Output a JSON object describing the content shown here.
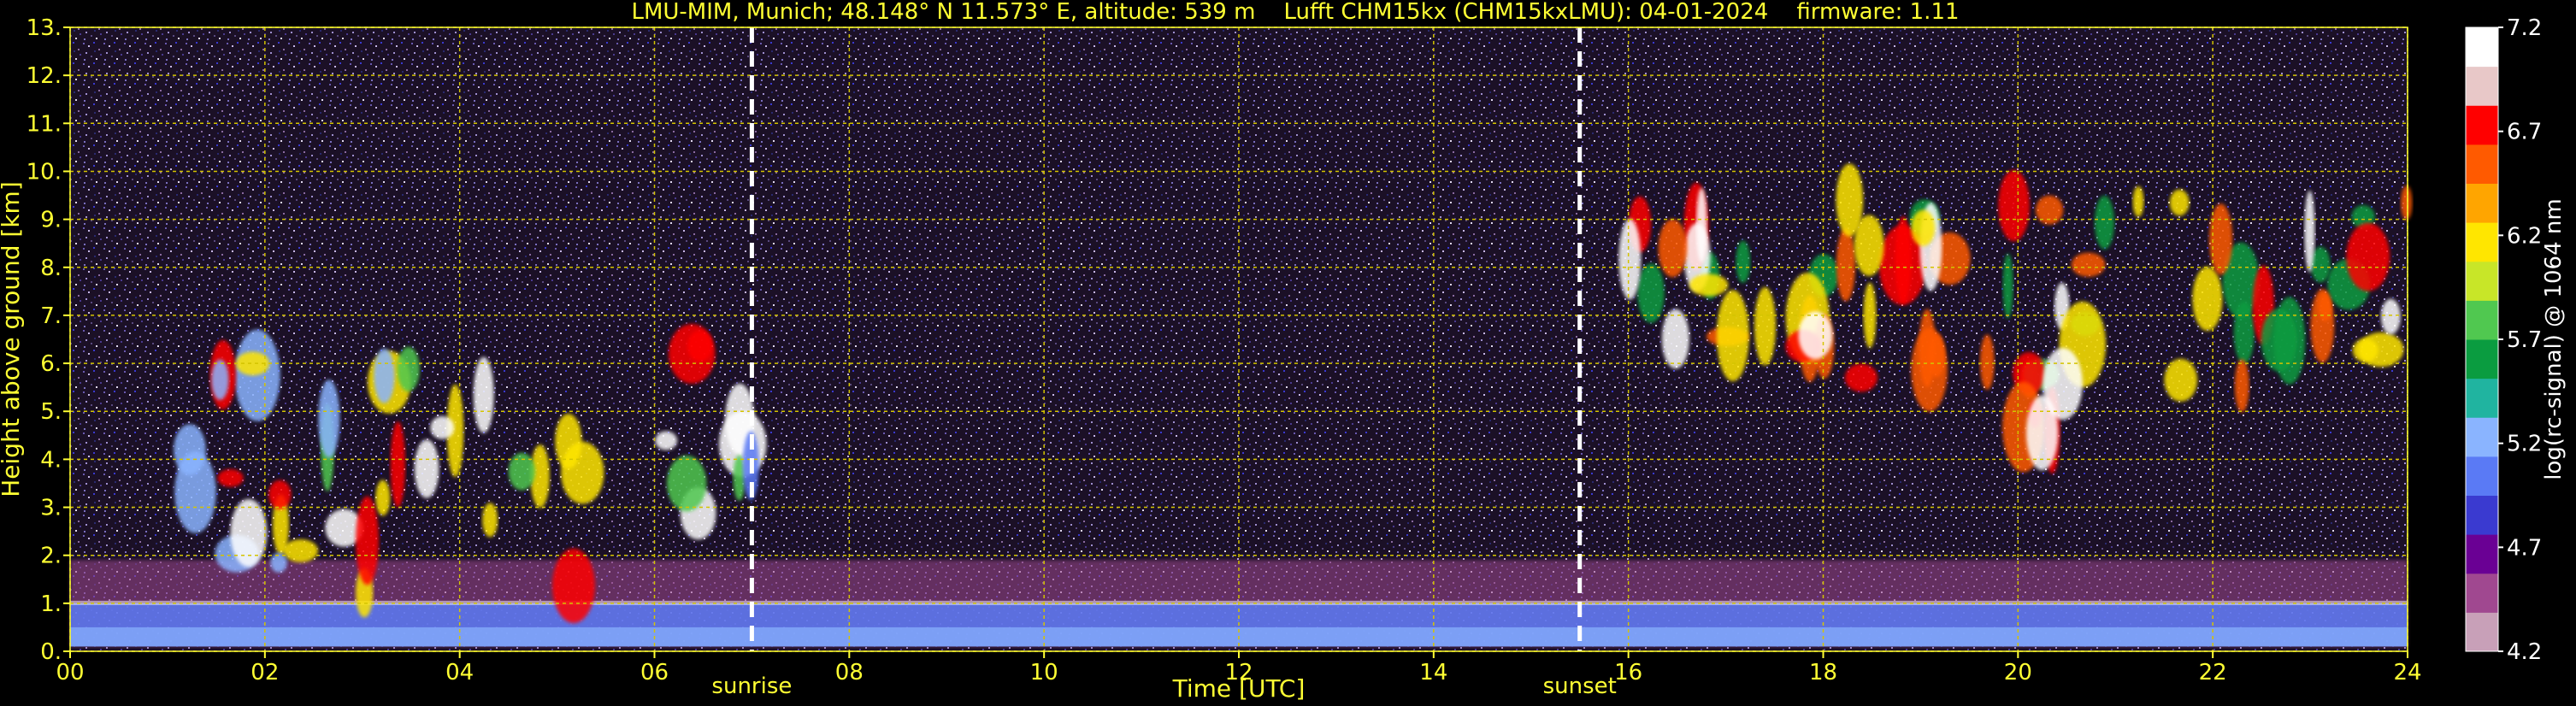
{
  "chart_data": {
    "type": "heatmap",
    "title": "LMU-MIM, Munich; 48.148° N 11.573° E, altitude: 539 m    Lufft CHM15kx (CHM15kxLMU): 04-01-2024    firmware: 1.11",
    "xlabel": "Time [UTC]",
    "ylabel": "Height above ground [km]",
    "colorbar_label": "log(rc-signal) @ 1064 nm",
    "xlim": [
      0,
      24
    ],
    "ylim": [
      0,
      13
    ],
    "xticks": [
      "00",
      "02",
      "04",
      "06",
      "08",
      "10",
      "12",
      "14",
      "16",
      "18",
      "20",
      "22",
      "24"
    ],
    "yticks": [
      "0.",
      "1.",
      "2.",
      "3.",
      "4.",
      "5.",
      "6.",
      "7.",
      "8.",
      "9.",
      "10.",
      "11.",
      "12.",
      "13."
    ],
    "colorbar_ticks": [
      "4.2",
      "4.7",
      "5.2",
      "5.7",
      "6.2",
      "6.7",
      "7.2"
    ],
    "colorbar_range": [
      4.2,
      7.2
    ],
    "grid": true,
    "events": [
      {
        "label": "sunrise",
        "time_h": 7.0
      },
      {
        "label": "sunset",
        "time_h": 15.5
      }
    ],
    "features": [
      {
        "name": "boundary layer aerosol",
        "t_start": 0,
        "t_end": 24,
        "z_bottom_km": 0.1,
        "z_top_km": 1.9
      },
      {
        "name": "low/mid cloud convective cells",
        "t_start": 1.2,
        "t_end": 5.3,
        "z_bottom_km": 1.0,
        "z_top_km": 6.0
      },
      {
        "name": "cloud near 06-07 UTC",
        "t_start": 5.9,
        "t_end": 7.0,
        "z_bottom_km": 2.5,
        "z_top_km": 6.5
      },
      {
        "name": "cirrus layer",
        "t_start": 16.0,
        "t_end": 24.0,
        "z_bottom_km": 5.5,
        "z_top_km": 9.4
      },
      {
        "name": "fall streak",
        "t_start": 20.0,
        "t_end": 20.7,
        "z_bottom_km": 3.8,
        "z_top_km": 6.0
      }
    ],
    "colors": {
      "title": "#ffff33",
      "axis_text": "#ffff33",
      "grid": "#d4c400",
      "colorbar_text": "#ffffff",
      "colormap": [
        "#c8a0b8",
        "#a04890",
        "#6a0094",
        "#3a3ad0",
        "#5a7af5",
        "#8ab4ff",
        "#20b4a0",
        "#0a9c40",
        "#50c850",
        "#c8e628",
        "#ffe600",
        "#ffa500",
        "#ff5a00",
        "#ff0000",
        "#e8c8c8",
        "#ffffff"
      ]
    }
  }
}
